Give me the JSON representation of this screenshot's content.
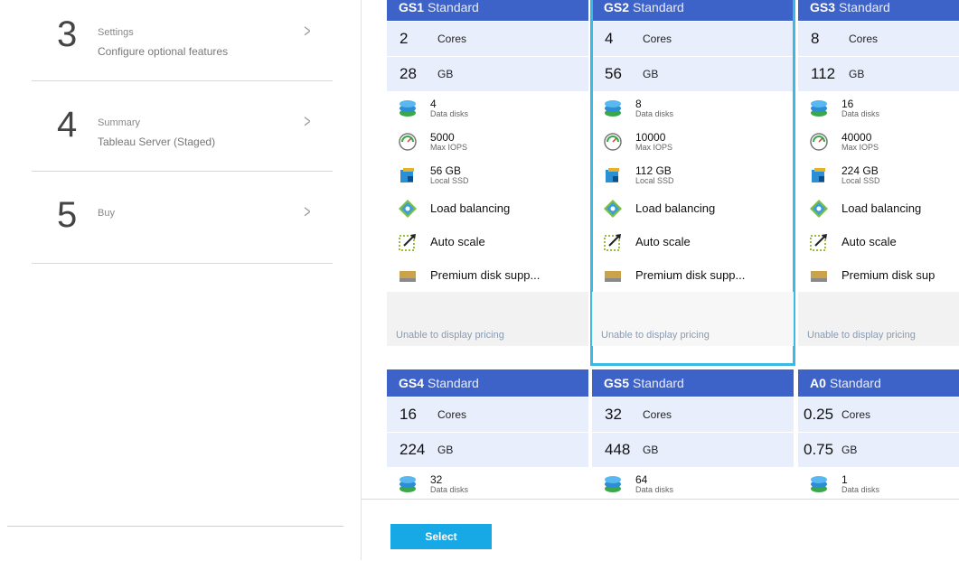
{
  "wizard": {
    "steps": [
      {
        "number": "3",
        "title": "Settings",
        "subtitle": "Configure optional features"
      },
      {
        "number": "4",
        "title": "Summary",
        "subtitle": "Tableau Server (Staged)"
      },
      {
        "number": "5",
        "title": "Buy",
        "subtitle": ""
      }
    ]
  },
  "sizes": [
    {
      "sku": "GS1",
      "tier": "Standard",
      "cores_value": "2",
      "cores_unit": "Cores",
      "mem_value": "28",
      "mem_unit": "GB",
      "disks": "4",
      "disks_label": "Data disks",
      "iops": "5000",
      "iops_label": "Max IOPS",
      "ssd": "56 GB",
      "ssd_label": "Local SSD",
      "lb": "Load balancing",
      "autoscale": "Auto scale",
      "premium": "Premium disk supp...",
      "pricing": "Unable to display pricing"
    },
    {
      "sku": "GS2",
      "tier": "Standard",
      "cores_value": "4",
      "cores_unit": "Cores",
      "mem_value": "56",
      "mem_unit": "GB",
      "disks": "8",
      "disks_label": "Data disks",
      "iops": "10000",
      "iops_label": "Max IOPS",
      "ssd": "112 GB",
      "ssd_label": "Local SSD",
      "lb": "Load balancing",
      "autoscale": "Auto scale",
      "premium": "Premium disk supp...",
      "pricing": "Unable to display pricing"
    },
    {
      "sku": "GS3",
      "tier": "Standard",
      "cores_value": "8",
      "cores_unit": "Cores",
      "mem_value": "112",
      "mem_unit": "GB",
      "disks": "16",
      "disks_label": "Data disks",
      "iops": "40000",
      "iops_label": "Max IOPS",
      "ssd": "224 GB",
      "ssd_label": "Local SSD",
      "lb": "Load balancing",
      "autoscale": "Auto scale",
      "premium": "Premium disk sup",
      "pricing": "Unable to display pricing"
    },
    {
      "sku": "GS4",
      "tier": "Standard",
      "cores_value": "16",
      "cores_unit": "Cores",
      "mem_value": "224",
      "mem_unit": "GB",
      "disks": "32",
      "disks_label": "Data disks"
    },
    {
      "sku": "GS5",
      "tier": "Standard",
      "cores_value": "32",
      "cores_unit": "Cores",
      "mem_value": "448",
      "mem_unit": "GB",
      "disks": "64",
      "disks_label": "Data disks"
    },
    {
      "sku": "A0",
      "tier": "Standard",
      "cores_value": "0.25",
      "cores_unit": "Cores",
      "mem_value": "0.75",
      "mem_unit": "GB",
      "disks": "1",
      "disks_label": "Data disks"
    }
  ],
  "selected_sku": "GS2",
  "actions": {
    "select_label": "Select"
  },
  "colors": {
    "header": "#3d63c9",
    "spec_bg": "#e9eefc",
    "selected_outline": "#3cb9e2",
    "button": "#16a9e6"
  }
}
